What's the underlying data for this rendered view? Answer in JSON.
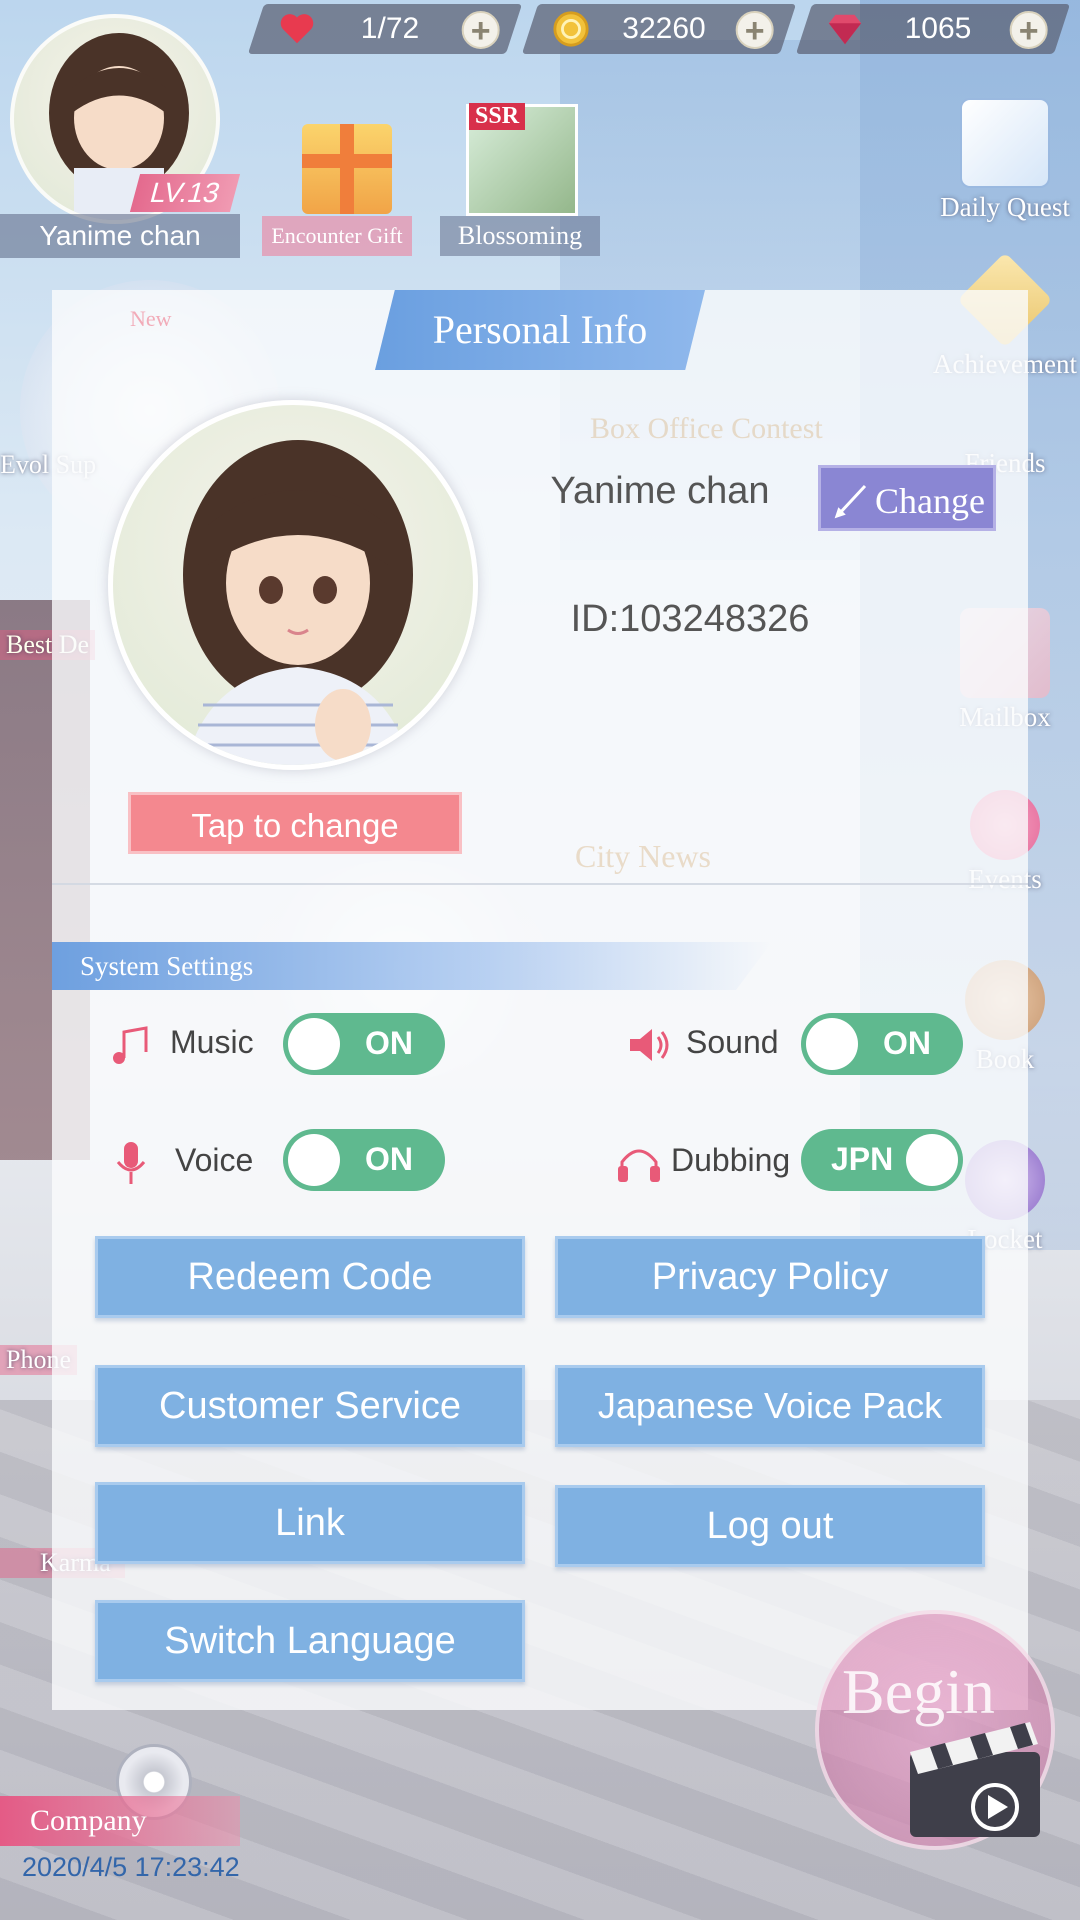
{
  "currency": {
    "stamina": "1/72",
    "gold": "32260",
    "diamonds": "1065"
  },
  "top_profile": {
    "level": "LV.13",
    "name": "Yanime chan"
  },
  "top_tiles": {
    "encounter_gift": "Encounter Gift",
    "blossoming": "Blossoming",
    "ssr_tag": "SSR"
  },
  "side_menu": {
    "daily_quest": "Daily Quest",
    "achievement": "Achievement",
    "friends": "Friends",
    "mailbox": "Mailbox",
    "events": "Events",
    "book": "Book",
    "locket": "Locket"
  },
  "left_menu": {
    "evol_support": "Evol Sup",
    "best_deals": "Best De",
    "phone": "Phone",
    "karma": "Karma",
    "company": "Company"
  },
  "background_labels": {
    "box_office": "Box Office Contest",
    "city_news": "City News",
    "new_badge": "New"
  },
  "personal_info": {
    "title": "Personal Info",
    "name": "Yanime chan",
    "change_label": "Change",
    "id": "ID:103248326",
    "tap_to_change": "Tap to change"
  },
  "system_settings": {
    "title": "System Settings",
    "music": {
      "label": "Music",
      "state": "ON"
    },
    "sound": {
      "label": "Sound",
      "state": "ON"
    },
    "voice": {
      "label": "Voice",
      "state": "ON"
    },
    "dubbing": {
      "label": "Dubbing",
      "state": "JPN"
    }
  },
  "buttons": {
    "redeem_code": "Redeem Code",
    "privacy_policy": "Privacy Policy",
    "customer_service": "Customer Service",
    "japanese_voice_pack": "Japanese Voice Pack",
    "link": "Link",
    "log_out": "Log out",
    "switch_language": "Switch Language"
  },
  "bottom": {
    "timestamp": "2020/4/5 17:23:42",
    "begin": "Begin"
  },
  "colors": {
    "toggle_on": "#5fb98f",
    "button_blue": "#7fb1e2",
    "accent_pink": "#f4888f",
    "change_purple": "#8a86d3"
  }
}
